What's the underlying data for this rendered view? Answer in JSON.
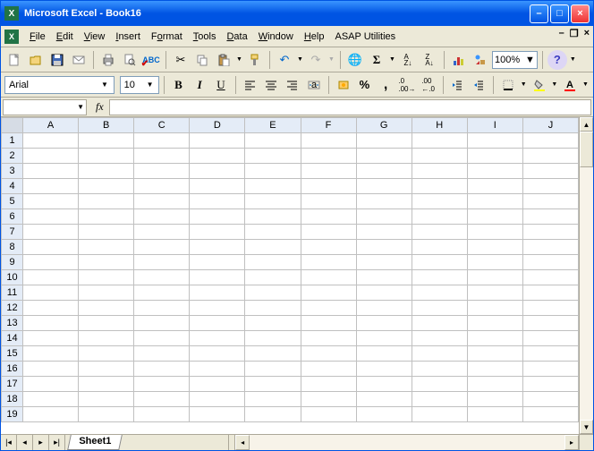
{
  "window": {
    "title": "Microsoft Excel - Book16"
  },
  "menus": {
    "file": "File",
    "edit": "Edit",
    "view": "View",
    "insert": "Insert",
    "format": "Format",
    "tools": "Tools",
    "data": "Data",
    "window": "Window",
    "help": "Help",
    "asap": "ASAP Utilities"
  },
  "toolbar": {
    "zoom": "100%"
  },
  "format": {
    "font": "Arial",
    "size": "10",
    "bold": "B",
    "italic": "I",
    "underline": "U"
  },
  "namebox": {
    "value": ""
  },
  "columns": [
    "A",
    "B",
    "C",
    "D",
    "E",
    "F",
    "G",
    "H",
    "I",
    "J"
  ],
  "rows": [
    "1",
    "2",
    "3",
    "4",
    "5",
    "6",
    "7",
    "8",
    "9",
    "10",
    "11",
    "12",
    "13",
    "14",
    "15",
    "16",
    "17",
    "18",
    "19"
  ],
  "sheet": {
    "tab": "Sheet1"
  },
  "cells": {}
}
